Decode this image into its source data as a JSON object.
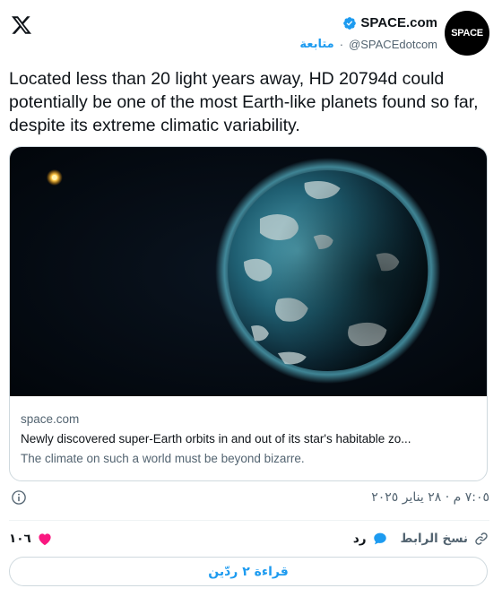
{
  "author": {
    "display_name": "SPACE.com",
    "handle": "@SPACEdotcom",
    "follow_label": "متابعة",
    "avatar_text": "SPACE"
  },
  "tweet": {
    "text": "Located less than 20 light years away, HD 20794d could potentially be one of the most Earth-like planets found so far, despite its extreme climatic variability.",
    "timestamp": "٧:٠٥ م · ٢٨ يناير ٢٠٢٥"
  },
  "card": {
    "domain": "space.com",
    "title": "Newly discovered super-Earth orbits in and out of its star's habitable zo...",
    "description": "The climate on such a world must be beyond bizarre.",
    "image": "planet-illustration"
  },
  "actions": {
    "like_count": "١٠٦",
    "reply_label": "رد",
    "copy_link_label": "نسخ الرابط"
  },
  "replies_button": {
    "label": "قراءة ٢ ردّين"
  },
  "colors": {
    "accent": "#1d9bf0",
    "like": "#f91880",
    "muted": "#536471",
    "border": "#cfd9de"
  },
  "icons": {
    "x_logo": "x-logo",
    "verified": "verified-badge-icon",
    "info": "info-icon",
    "like": "heart-icon",
    "reply": "reply-bubble-icon",
    "copy": "link-icon"
  }
}
